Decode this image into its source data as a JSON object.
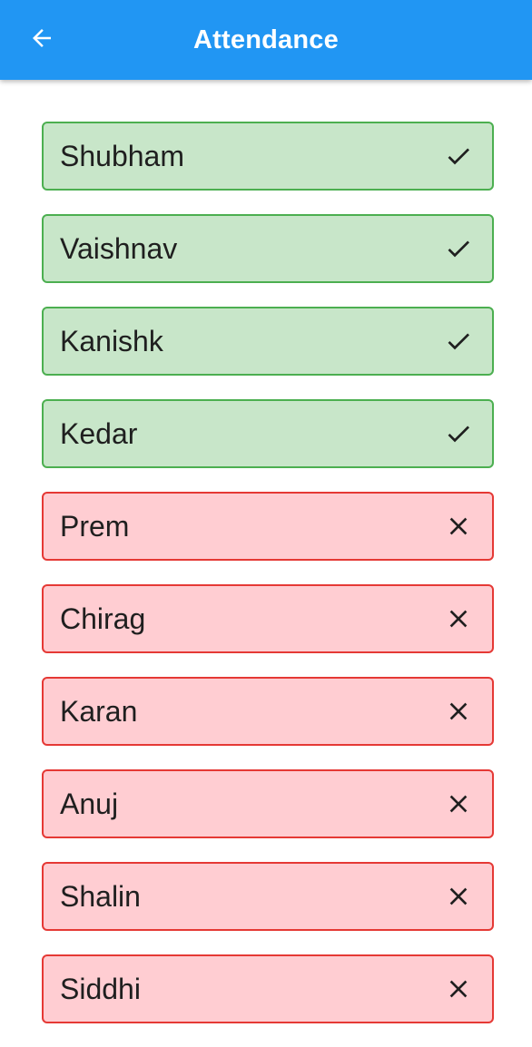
{
  "appbar": {
    "title": "Attendance",
    "back_icon": "arrow-back-icon",
    "color": "#2196f3"
  },
  "colors": {
    "present_bg": "#c8e6c9",
    "present_border": "#4caf50",
    "absent_bg": "#ffcdd2",
    "absent_border": "#e53935"
  },
  "students": [
    {
      "name": "Shubham",
      "status": "present",
      "icon": "check-icon"
    },
    {
      "name": "Vaishnav",
      "status": "present",
      "icon": "check-icon"
    },
    {
      "name": "Kanishk",
      "status": "present",
      "icon": "check-icon"
    },
    {
      "name": "Kedar",
      "status": "present",
      "icon": "check-icon"
    },
    {
      "name": "Prem",
      "status": "absent",
      "icon": "close-icon"
    },
    {
      "name": "Chirag",
      "status": "absent",
      "icon": "close-icon"
    },
    {
      "name": "Karan",
      "status": "absent",
      "icon": "close-icon"
    },
    {
      "name": "Anuj",
      "status": "absent",
      "icon": "close-icon"
    },
    {
      "name": "Shalin",
      "status": "absent",
      "icon": "close-icon"
    },
    {
      "name": "Siddhi",
      "status": "absent",
      "icon": "close-icon"
    }
  ]
}
